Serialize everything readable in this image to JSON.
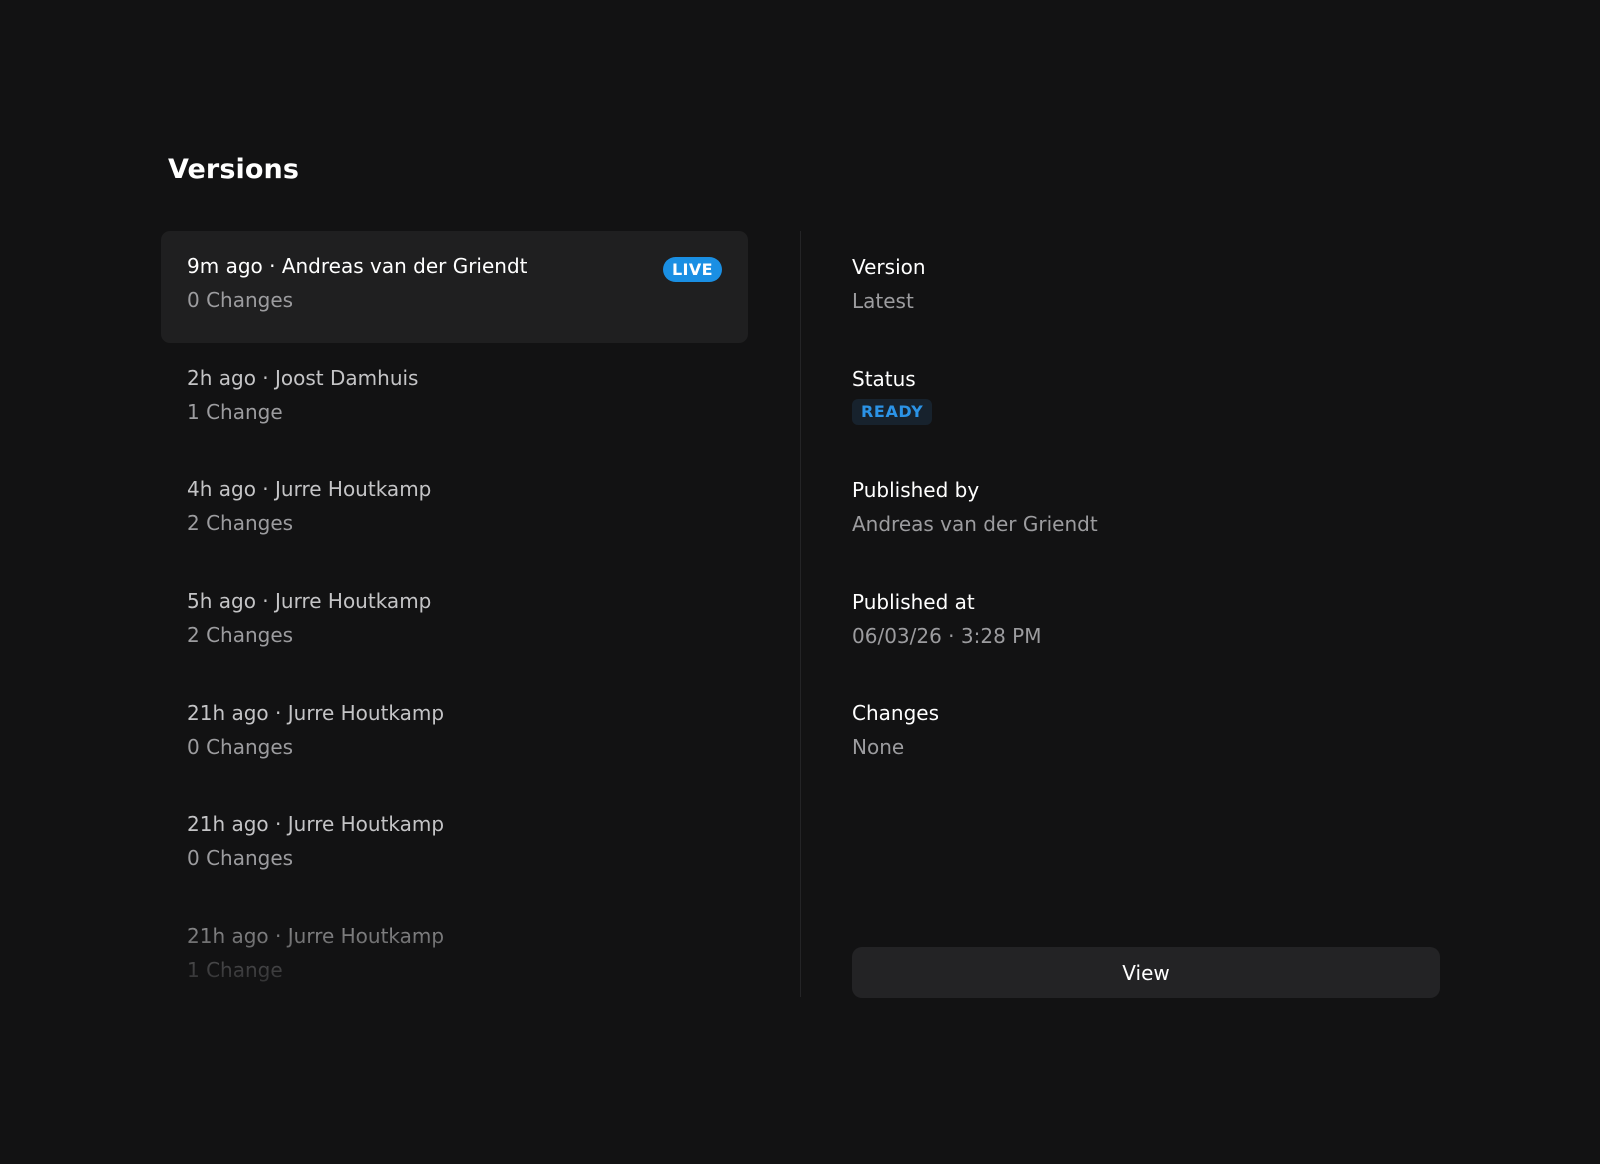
{
  "page": {
    "title": "Versions"
  },
  "versions": [
    {
      "title": "9m ago · Andreas van der Griendt",
      "changes": "0 Changes",
      "badge": "LIVE",
      "selected": true
    },
    {
      "title": "2h ago · Joost Damhuis",
      "changes": "1 Change"
    },
    {
      "title": "4h ago · Jurre Houtkamp",
      "changes": "2 Changes"
    },
    {
      "title": "5h ago · Jurre Houtkamp",
      "changes": "2 Changes"
    },
    {
      "title": "21h ago · Jurre Houtkamp",
      "changes": "0 Changes"
    },
    {
      "title": "21h ago · Jurre Houtkamp",
      "changes": "0 Changes"
    },
    {
      "title": "21h ago · Jurre Houtkamp",
      "changes": "1 Change"
    }
  ],
  "details": {
    "version": {
      "label": "Version",
      "value": "Latest"
    },
    "status": {
      "label": "Status",
      "value": "READY"
    },
    "published_by": {
      "label": "Published by",
      "value": "Andreas van der Griendt"
    },
    "published_at": {
      "label": "Published at",
      "value": "06/03/26 · 3:28 PM"
    },
    "changes": {
      "label": "Changes",
      "value": "None"
    }
  },
  "actions": {
    "view_label": "View"
  },
  "colors": {
    "background": "#121213",
    "selected_row": "#1f1f20",
    "live_badge": "#1a8fe3",
    "status_text": "#2b93e6",
    "status_bg": "#17222d",
    "button_bg": "#232325"
  }
}
